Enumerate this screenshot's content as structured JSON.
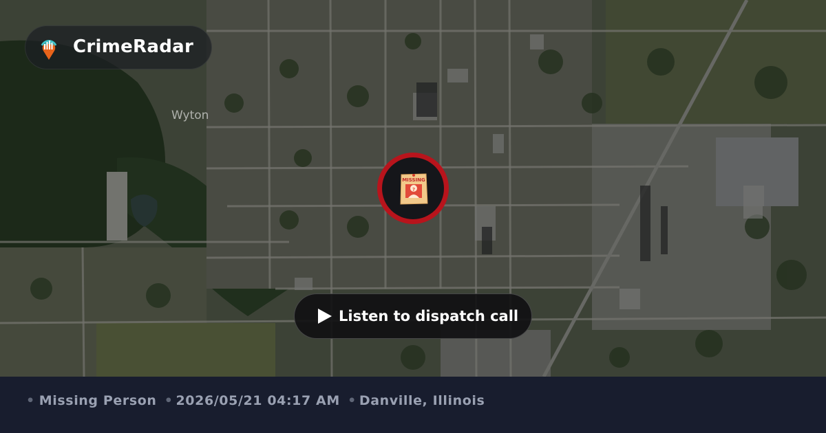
{
  "brand": {
    "name": "CrimeRadar",
    "icon": "radar-pin-icon"
  },
  "map": {
    "place_label": "Wyton",
    "style": "satellite"
  },
  "incident": {
    "icon": "missing-poster-icon",
    "poster_text": "MISSING",
    "ring_color": "#b8141c"
  },
  "dispatch": {
    "label": "Listen to dispatch call",
    "icon": "play-icon"
  },
  "footer": {
    "category": "Missing Person",
    "datetime": "2026/05/21 04:17 AM",
    "location": "Danville, Illinois"
  }
}
